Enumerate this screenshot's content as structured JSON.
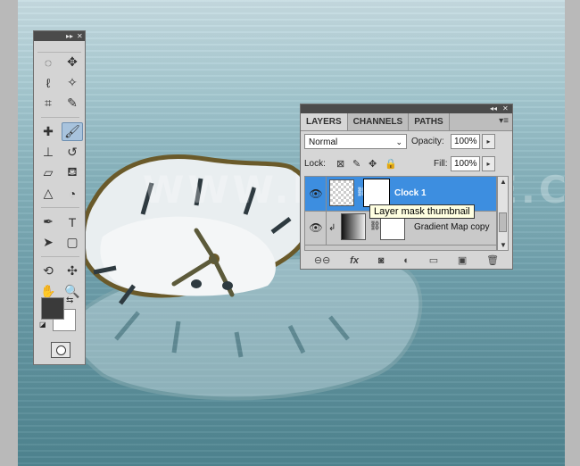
{
  "canvas": {
    "watermark": "WWW.PSDDUDE.COM"
  },
  "toolbox": {
    "tools": [
      {
        "name": "marquee-tool-icon",
        "glyph": "◌"
      },
      {
        "name": "move-tool-icon",
        "glyph": "✥"
      },
      {
        "name": "lasso-tool-icon",
        "glyph": "ℓ"
      },
      {
        "name": "magic-wand-tool-icon",
        "glyph": "✧"
      },
      {
        "name": "crop-tool-icon",
        "glyph": "⌗"
      },
      {
        "name": "eyedropper-tool-icon",
        "glyph": "✎"
      },
      {
        "name": "healing-brush-tool-icon",
        "glyph": "✚"
      },
      {
        "name": "brush-tool-icon",
        "glyph": "🖌"
      },
      {
        "name": "clone-stamp-tool-icon",
        "glyph": "⊥"
      },
      {
        "name": "history-brush-tool-icon",
        "glyph": "↺"
      },
      {
        "name": "eraser-tool-icon",
        "glyph": "▱"
      },
      {
        "name": "paint-bucket-tool-icon",
        "glyph": "⛾"
      },
      {
        "name": "blur-tool-icon",
        "glyph": "△"
      },
      {
        "name": "dodge-tool-icon",
        "glyph": "◔"
      },
      {
        "name": "pen-tool-icon",
        "glyph": "✒"
      },
      {
        "name": "type-tool-icon",
        "glyph": "T"
      },
      {
        "name": "path-selection-tool-icon",
        "glyph": "➤"
      },
      {
        "name": "shape-tool-icon",
        "glyph": "▢"
      },
      {
        "name": "3d-rotate-tool-icon",
        "glyph": "⟲"
      },
      {
        "name": "3d-pan-tool-icon",
        "glyph": "✣"
      },
      {
        "name": "hand-tool-icon",
        "glyph": "✋"
      },
      {
        "name": "zoom-tool-icon",
        "glyph": "🔍"
      }
    ],
    "foreground_color": "#3a3a3a",
    "background_color": "#ffffff"
  },
  "layers_panel": {
    "tabs": [
      "LAYERS",
      "CHANNELS",
      "PATHS"
    ],
    "blend_mode": "Normal",
    "opacity_label": "Opacity:",
    "opacity_value": "100%",
    "lock_label": "Lock:",
    "fill_label": "Fill:",
    "fill_value": "100%",
    "layers": [
      {
        "name": "Clock 1",
        "selected": true
      },
      {
        "name": "Gradient Map copy",
        "selected": false
      }
    ],
    "footer_icons": [
      "link-icon",
      "fx-icon",
      "mask-icon",
      "adjustment-icon",
      "folder-icon",
      "new-layer-icon",
      "trash-icon"
    ],
    "footer_glyphs": {
      "link": "⊖⊖",
      "fx": "fx",
      "mask": "◙",
      "adjust": "◐",
      "folder": "▭",
      "newlayer": "▣",
      "trash": "🗑"
    },
    "selection_color": "#3d8ee0"
  },
  "tooltip": "Layer mask thumbnail"
}
